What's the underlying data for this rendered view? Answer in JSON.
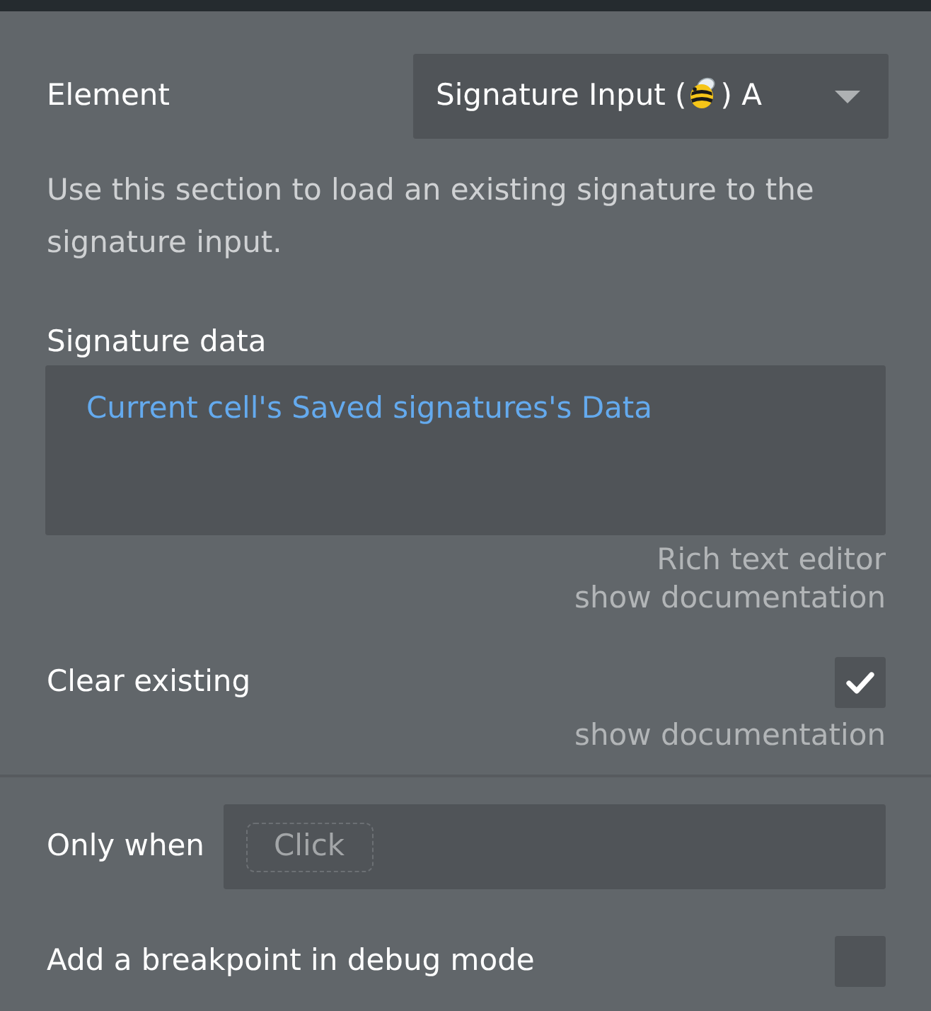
{
  "element_row": {
    "label": "Element",
    "dropdown": {
      "value_start": "Signature Input (",
      "value_end": ") A"
    }
  },
  "description": "Use this section to load an existing signature to the signature input.",
  "signature_data": {
    "label": "Signature data",
    "value": "Current cell's Saved signatures's Data",
    "hint": "Rich text editor",
    "doc_link": "show documentation"
  },
  "clear_existing": {
    "label": "Clear existing",
    "checked": true,
    "doc_link": "show documentation"
  },
  "only_when": {
    "label": "Only when",
    "placeholder": "Click"
  },
  "breakpoint": {
    "label": "Add a breakpoint in debug mode",
    "checked": false
  }
}
